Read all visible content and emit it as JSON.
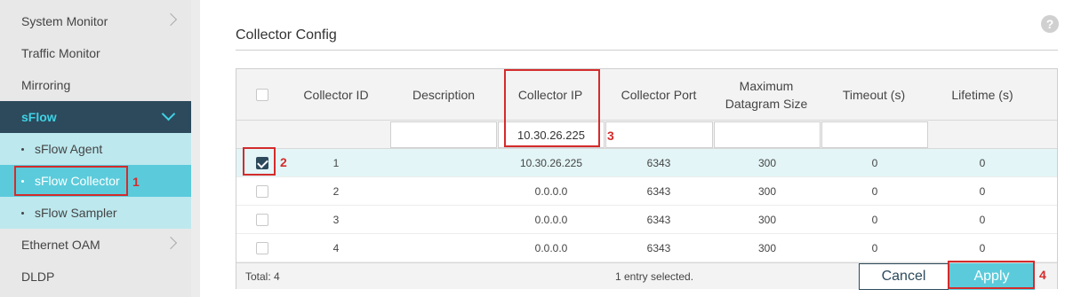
{
  "sidebar": {
    "items": [
      {
        "label": "System Monitor"
      },
      {
        "label": "Traffic Monitor"
      },
      {
        "label": "Mirroring"
      },
      {
        "label": "sFlow"
      },
      {
        "label": "sFlow Agent"
      },
      {
        "label": "sFlow Collector"
      },
      {
        "label": "sFlow Sampler"
      },
      {
        "label": "Ethernet OAM"
      },
      {
        "label": "DLDP"
      }
    ]
  },
  "annotations": {
    "n1": "1",
    "n2": "2",
    "n3": "3",
    "n4": "4"
  },
  "main": {
    "title": "Collector Config",
    "help_icon": "?",
    "columns": [
      "Collector ID",
      "Description",
      "Collector IP",
      "Collector Port",
      "Maximum Datagram Size",
      "Timeout (s)",
      "Lifetime (s)"
    ],
    "filter": {
      "collector_ip": "10.30.26.225",
      "description": "",
      "collector_port": "",
      "max_size": "",
      "timeout": ""
    },
    "rows": [
      {
        "checked": true,
        "id": "1",
        "description": "",
        "ip": "10.30.26.225",
        "port": "6343",
        "size": "300",
        "timeout": "0",
        "lifetime": "0"
      },
      {
        "checked": false,
        "id": "2",
        "description": "",
        "ip": "0.0.0.0",
        "port": "6343",
        "size": "300",
        "timeout": "0",
        "lifetime": "0"
      },
      {
        "checked": false,
        "id": "3",
        "description": "",
        "ip": "0.0.0.0",
        "port": "6343",
        "size": "300",
        "timeout": "0",
        "lifetime": "0"
      },
      {
        "checked": false,
        "id": "4",
        "description": "",
        "ip": "0.0.0.0",
        "port": "6343",
        "size": "300",
        "timeout": "0",
        "lifetime": "0"
      }
    ],
    "footer": {
      "total": "Total: 4",
      "selected": "1 entry selected."
    },
    "buttons": {
      "cancel": "Cancel",
      "apply": "Apply"
    }
  },
  "colors": {
    "accent": "#5bcbdb",
    "dark": "#2c4a5c",
    "annotation": "#d42b2b"
  }
}
